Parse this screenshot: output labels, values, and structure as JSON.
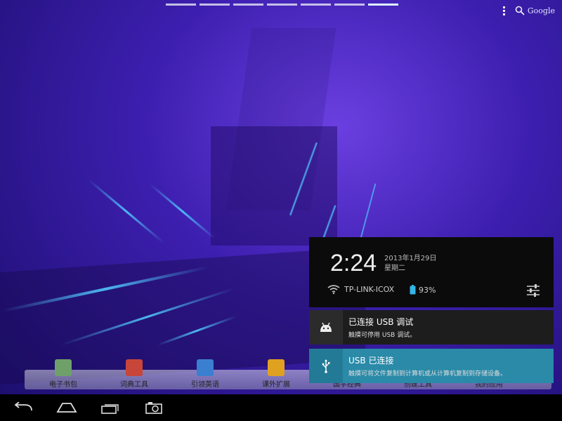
{
  "pager": {
    "count": 7,
    "active_index": 6
  },
  "topbar": {
    "search_label": "Google"
  },
  "dock": [
    {
      "label": "电子书包",
      "color": "#6fa06a"
    },
    {
      "label": "词典工具",
      "color": "#c8453a"
    },
    {
      "label": "引领英语",
      "color": "#3a7fd0"
    },
    {
      "label": "课外扩展",
      "color": "#e0a020"
    },
    {
      "label": "国学经典",
      "color": "#888888"
    },
    {
      "label": "创建工具",
      "color": "#888888"
    },
    {
      "label": "我的应用",
      "color": "#888888"
    }
  ],
  "panel": {
    "time": "2:24",
    "date": "2013年1月29日",
    "weekday": "星期二",
    "wifi_name": "TP-LINK-ICOX",
    "battery": "93%"
  },
  "notifications": [
    {
      "title": "已连接 USB 调试",
      "subtitle": "触摸可停用 USB 调试。",
      "icon": "android-icon"
    },
    {
      "title": "USB 已连接",
      "subtitle": "触摸可将文件复制到计算机或从计算机复制到存储设备。",
      "icon": "usb-icon"
    }
  ],
  "colors": {
    "accent": "#2a8aa8",
    "wallpaper": "#3d1fb0"
  }
}
